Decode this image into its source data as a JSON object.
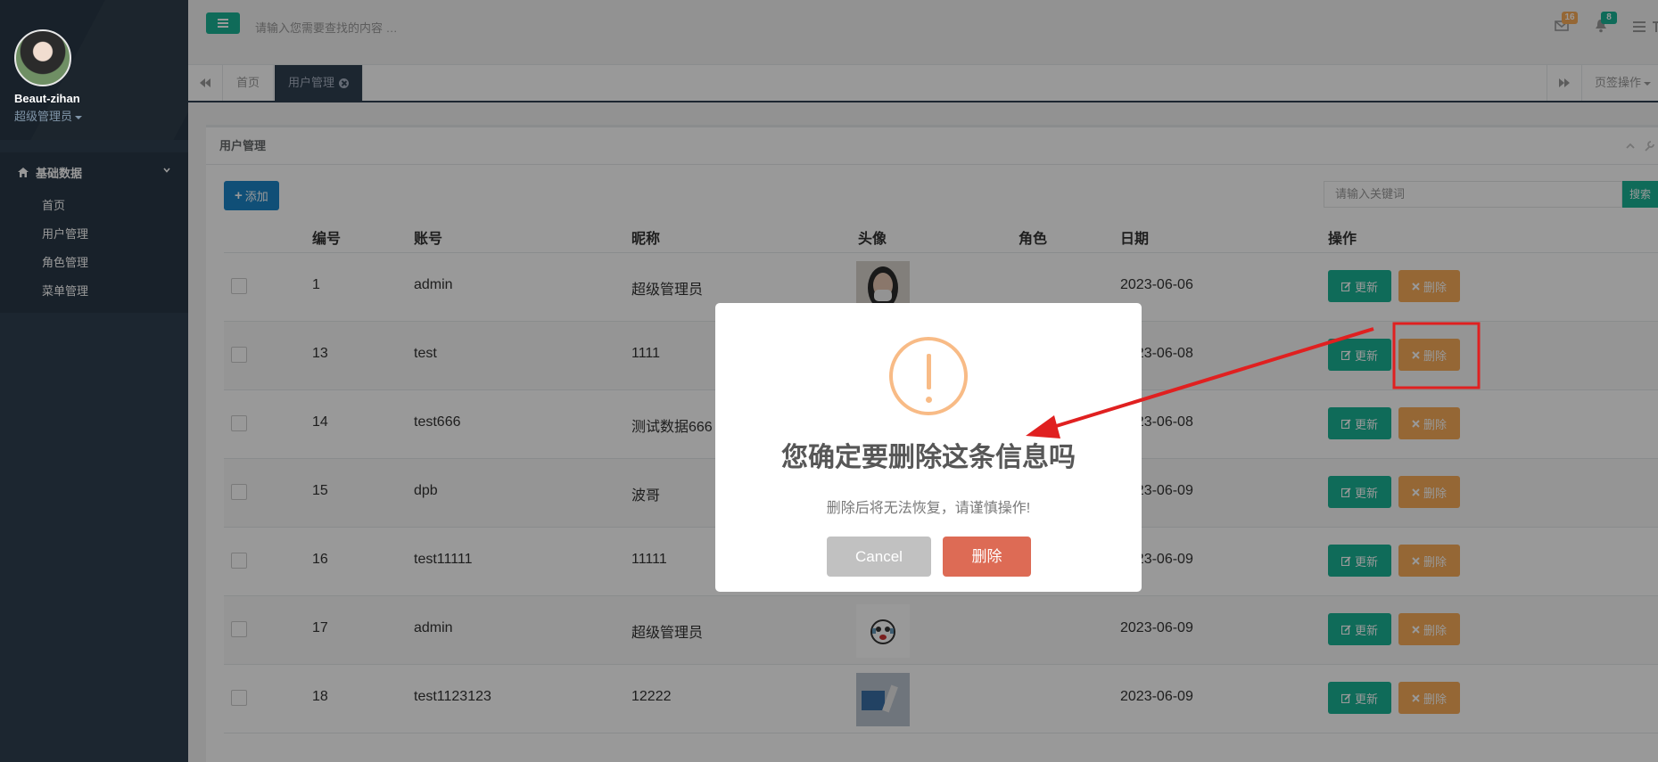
{
  "sidebar": {
    "profile": {
      "name": "Beaut-zihan",
      "role": "超级管理员"
    },
    "group": {
      "label": "基础数据"
    },
    "items": [
      {
        "label": "首页"
      },
      {
        "label": "用户管理"
      },
      {
        "label": "角色管理"
      },
      {
        "label": "菜单管理"
      }
    ]
  },
  "topbar": {
    "search_placeholder": "请输入您需要查找的内容 …",
    "mail_count": "16",
    "bell_count": "8",
    "mail_badge_color": "#f8ac59",
    "bell_badge_color": "#1ab394"
  },
  "tabs": {
    "items": [
      {
        "label": "首页"
      },
      {
        "label": "用户管理"
      }
    ],
    "ops_label": "页签操作"
  },
  "panel": {
    "title": "用户管理",
    "add_label": "添加",
    "keyword_placeholder": "请输入关键词",
    "search_label": "搜索"
  },
  "table": {
    "headers": {
      "id": "编号",
      "account": "账号",
      "nickname": "昵称",
      "avatar": "头像",
      "role": "角色",
      "date": "日期",
      "actions": "操作"
    },
    "update_label": "更新",
    "delete_label": "删除",
    "rows": [
      {
        "id": "1",
        "account": "admin",
        "nickname": "超级管理员",
        "date": "2023-06-06",
        "avatar": "photo-woman-mask"
      },
      {
        "id": "13",
        "account": "test",
        "nickname": "1111",
        "date": "2023-06-08",
        "avatar": "none"
      },
      {
        "id": "14",
        "account": "test666",
        "nickname": "测试数据666",
        "date": "2023-06-08",
        "avatar": "none"
      },
      {
        "id": "15",
        "account": "dpb",
        "nickname": "波哥",
        "date": "2023-06-09",
        "avatar": "none"
      },
      {
        "id": "16",
        "account": "test11111",
        "nickname": "11111",
        "date": "2023-06-09",
        "avatar": "none"
      },
      {
        "id": "17",
        "account": "admin",
        "nickname": "超级管理员",
        "date": "2023-06-09",
        "avatar": "emoji-crying"
      },
      {
        "id": "18",
        "account": "test1123123",
        "nickname": "12222",
        "date": "2023-06-09",
        "avatar": "photo-blue-object"
      }
    ]
  },
  "dialog": {
    "title": "您确定要删除这条信息吗",
    "text": "删除后将无法恢复，请谨慎操作!",
    "cancel_label": "Cancel",
    "confirm_label": "删除",
    "icon": "warning-icon"
  },
  "annotation": {
    "color": "#e02020",
    "target": "row 13 delete button"
  },
  "colors": {
    "sidebar": "#2f4050",
    "primary": "#1ab394",
    "warning": "#f8ac59",
    "blue": "#1c84c6",
    "danger": "#dd6b55"
  }
}
